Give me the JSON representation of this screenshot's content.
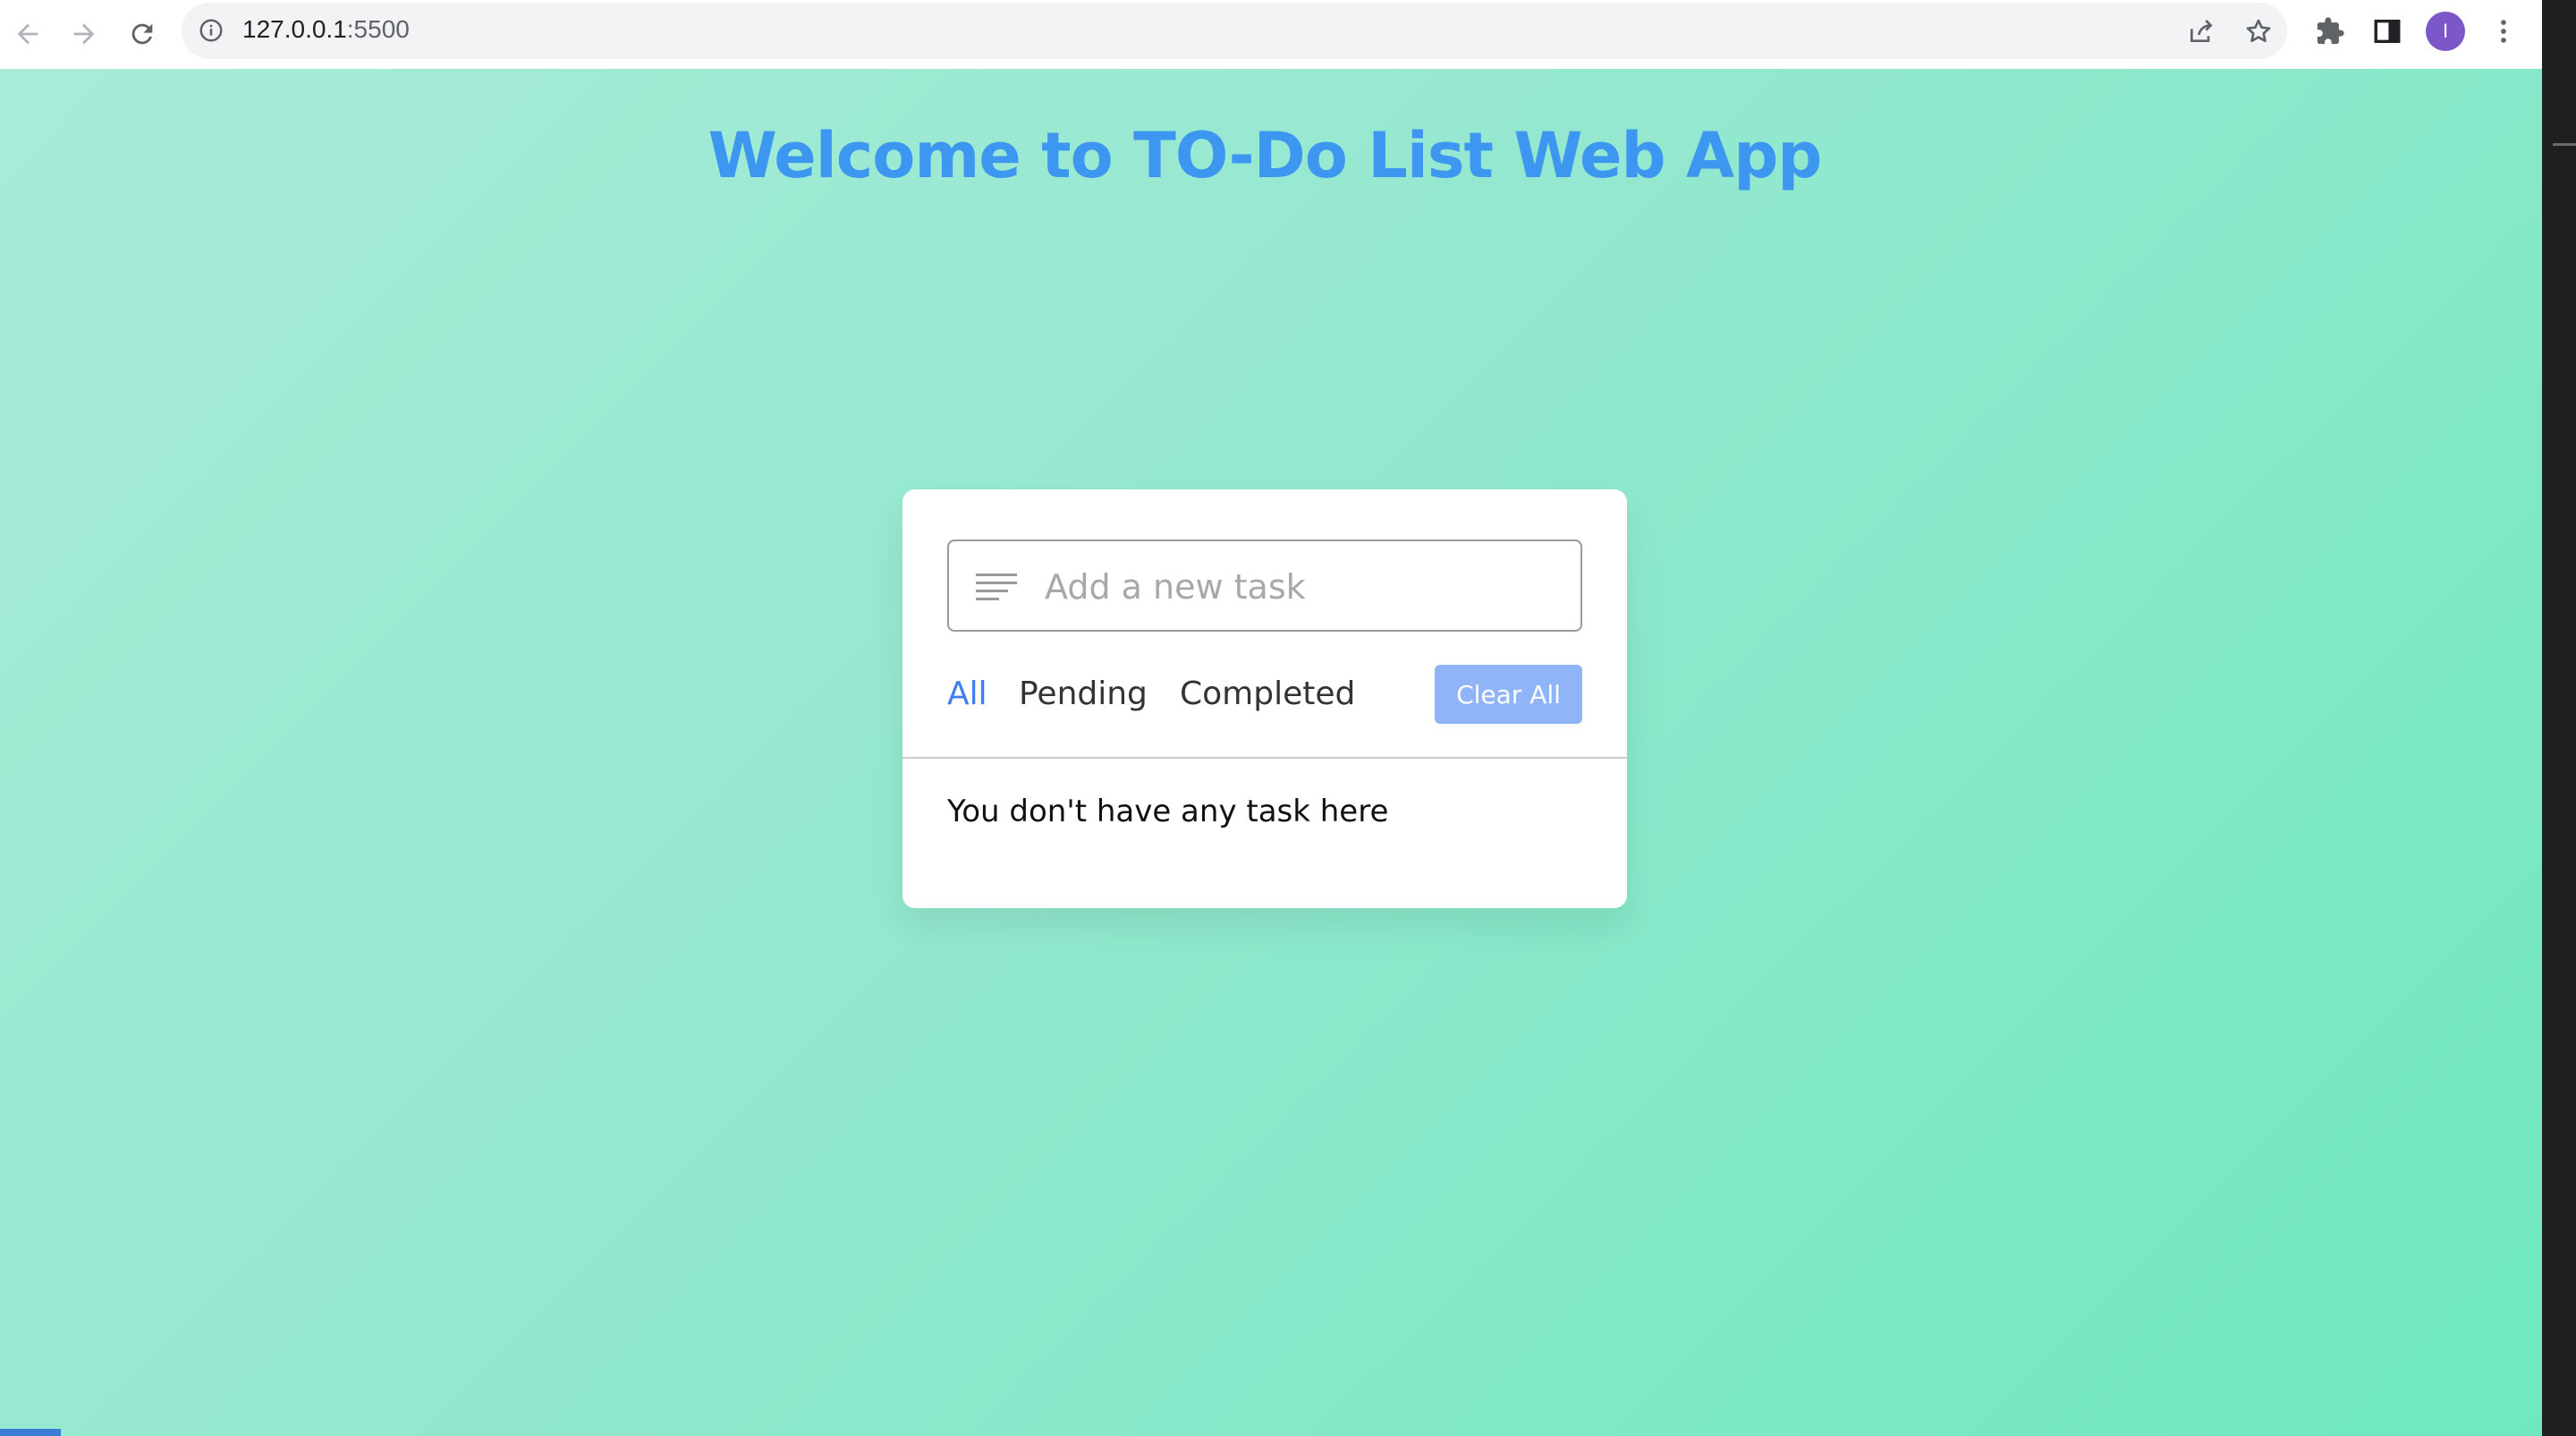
{
  "browser": {
    "url_host": "127.0.0.1",
    "url_port": ":5500",
    "avatar_letter": "I",
    "icons": {
      "back": "back-arrow-icon",
      "forward": "forward-arrow-icon",
      "reload": "reload-icon",
      "site_info": "info-icon",
      "share": "share-icon",
      "bookmark": "star-icon",
      "extensions": "puzzle-icon",
      "side_panel": "side-panel-icon",
      "menu": "kebab-menu-icon"
    }
  },
  "page": {
    "title": "Welcome to TO-Do List Web App",
    "title_color": "#3d96f0",
    "background": [
      "#a8ebd8",
      "#6fe8c0"
    ]
  },
  "todo": {
    "input_placeholder": "Add a new task",
    "input_value": "",
    "filters": [
      {
        "label": "All",
        "active": true
      },
      {
        "label": "Pending",
        "active": false
      },
      {
        "label": "Completed",
        "active": false
      }
    ],
    "clear_all_label": "Clear All",
    "clear_all_color": "#8fb4f7",
    "active_filter_color": "#3d7ef0",
    "empty_message": "You don't have any task here"
  }
}
